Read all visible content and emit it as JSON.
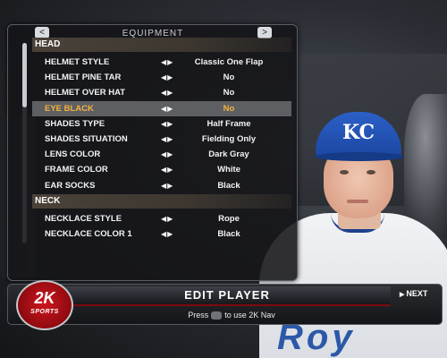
{
  "panel": {
    "title": "EQUIPMENT",
    "prev_arrow": "<",
    "next_arrow": ">",
    "sections": [
      {
        "name": "HEAD",
        "rows": [
          {
            "label": "HELMET STYLE",
            "value": "Classic One Flap"
          },
          {
            "label": "HELMET PINE TAR",
            "value": "No"
          },
          {
            "label": "HELMET OVER HAT",
            "value": "No"
          },
          {
            "label": "EYE BLACK",
            "value": "No",
            "selected": true
          },
          {
            "label": "SHADES TYPE",
            "value": "Half Frame"
          },
          {
            "label": "SHADES SITUATION",
            "value": "Fielding Only"
          },
          {
            "label": "LENS COLOR",
            "value": "Dark Gray"
          },
          {
            "label": "FRAME COLOR",
            "value": "White"
          },
          {
            "label": "EAR SOCKS",
            "value": "Black"
          }
        ]
      },
      {
        "name": "NECK",
        "rows": [
          {
            "label": "NECKLACE STYLE",
            "value": "Rope"
          },
          {
            "label": "NECKLACE COLOR 1",
            "value": "Black"
          }
        ]
      }
    ],
    "arrows_glyph": "◀▶"
  },
  "player": {
    "cap_logo": "KC",
    "jersey_lettering": "Roy"
  },
  "bottom_bar": {
    "title": "EDIT PLAYER",
    "next_label": "NEXT",
    "hint_prefix": "Press",
    "hint_suffix": "to use 2K Nav"
  },
  "logo": {
    "brand": "2K",
    "sub": "SPORTS"
  },
  "colors": {
    "selected_text": "#f4b23c",
    "selected_row": "#5d5f63",
    "cap_blue": "#1c46a0",
    "logo_red": "#d1161e"
  }
}
